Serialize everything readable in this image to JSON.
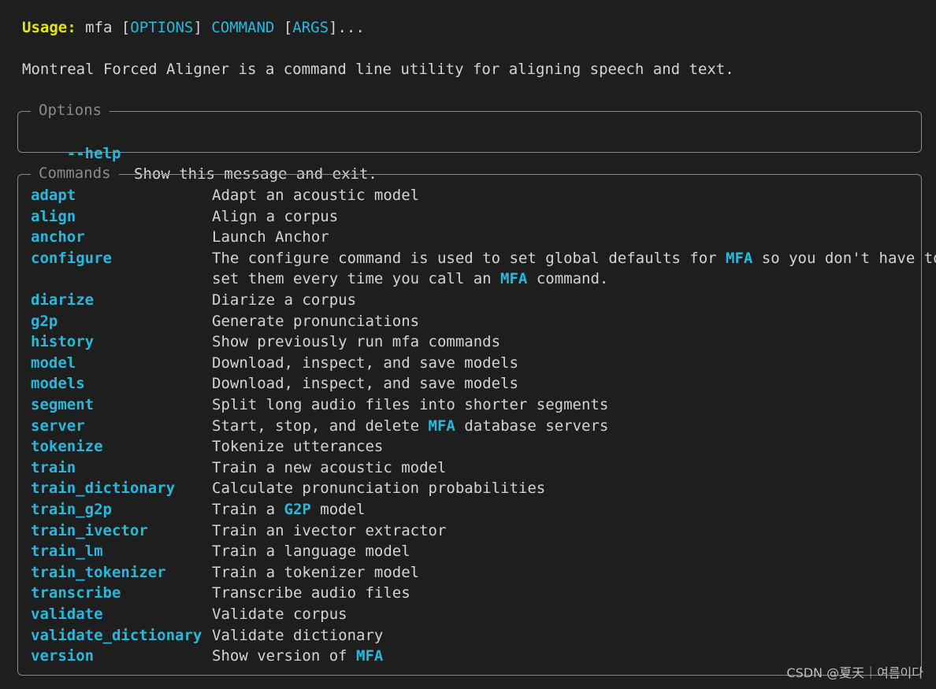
{
  "usage": {
    "label": "Usage:",
    "program": " mfa ",
    "open1": "[",
    "options": "OPTIONS",
    "close1": "]",
    "space": " ",
    "command": "COMMAND",
    "space2": " ",
    "open2": "[",
    "args": "ARGS",
    "close2": "]",
    "ellipsis": "..."
  },
  "description": "Montreal Forced Aligner is a command line utility for aligning speech and text.",
  "options_panel": {
    "title": "Options",
    "items": [
      {
        "name": "--help",
        "desc": "Show this message and exit."
      }
    ]
  },
  "commands_panel": {
    "title": "Commands",
    "items": [
      {
        "name": "adapt",
        "desc": "Adapt an acoustic model"
      },
      {
        "name": "align",
        "desc": "Align a corpus"
      },
      {
        "name": "anchor",
        "desc": "Launch Anchor"
      },
      {
        "name": "configure",
        "desc_a": "The configure command is used to set global defaults for ",
        "desc_hl1": "MFA",
        "desc_b": " so you don't have to",
        "desc_c": "set them every time you call an ",
        "desc_hl2": "MFA",
        "desc_d": " command."
      },
      {
        "name": "diarize",
        "desc": "Diarize a corpus"
      },
      {
        "name": "g2p",
        "desc": "Generate pronunciations"
      },
      {
        "name": "history",
        "desc": "Show previously run mfa commands"
      },
      {
        "name": "model",
        "desc": "Download, inspect, and save models"
      },
      {
        "name": "models",
        "desc": "Download, inspect, and save models"
      },
      {
        "name": "segment",
        "desc": "Split long audio files into shorter segments"
      },
      {
        "name": "server",
        "desc_a": "Start, stop, and delete ",
        "desc_hl1": "MFA",
        "desc_b": " database servers"
      },
      {
        "name": "tokenize",
        "desc": "Tokenize utterances"
      },
      {
        "name": "train",
        "desc": "Train a new acoustic model"
      },
      {
        "name": "train_dictionary",
        "desc": "Calculate pronunciation probabilities"
      },
      {
        "name": "train_g2p",
        "desc_a": "Train a ",
        "desc_hl1": "G2P",
        "desc_b": " model"
      },
      {
        "name": "train_ivector",
        "desc": "Train an ivector extractor"
      },
      {
        "name": "train_lm",
        "desc": "Train a language model"
      },
      {
        "name": "train_tokenizer",
        "desc": "Train a tokenizer model"
      },
      {
        "name": "transcribe",
        "desc": "Transcribe audio files"
      },
      {
        "name": "validate",
        "desc": "Validate corpus"
      },
      {
        "name": "validate_dictionary",
        "desc": "Validate dictionary"
      },
      {
        "name": "version",
        "desc_a": "Show version of ",
        "desc_hl1": "MFA"
      }
    ]
  },
  "watermark": "CSDN @夏天｜여름이다",
  "colors": {
    "background": "#1e1e1e",
    "text": "#d4d4d4",
    "accent": "#29b8db",
    "usage_label": "#e5e510",
    "border": "#8a8a8a"
  }
}
